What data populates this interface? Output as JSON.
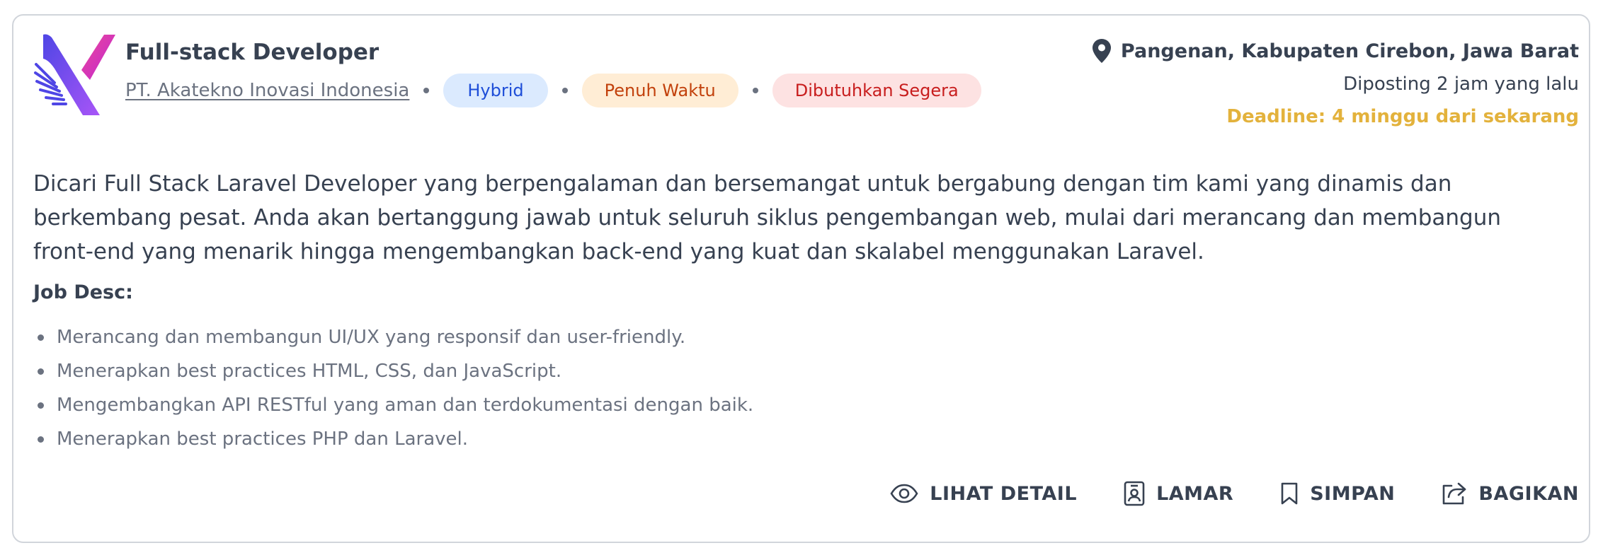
{
  "job": {
    "title": "Full-stack Developer",
    "company": "PT. Akatekno Inovasi Indonesia",
    "tags": [
      {
        "label": "Hybrid",
        "bg": "#dbeafe",
        "color": "#1e4ed8"
      },
      {
        "label": "Penuh Waktu",
        "bg": "#ffedd5",
        "color": "#c2410c"
      },
      {
        "label": "Dibutuhkan Segera",
        "bg": "#fde2e2",
        "color": "#c81e1e"
      }
    ],
    "location": "Pangenan, Kabupaten Cirebon, Jawa Barat",
    "posted": "Diposting 2 jam yang lalu",
    "deadline": "Deadline: 4 minggu dari sekarang",
    "description": "Dicari Full Stack Laravel Developer yang berpengalaman dan bersemangat untuk bergabung dengan tim kami yang dinamis dan berkembang pesat. Anda akan bertanggung jawab untuk seluruh siklus pengembangan web, mulai dari merancang dan membangun front-end yang menarik hingga mengembangkan back-end yang kuat dan skalabel menggunakan Laravel.",
    "job_desc_label": "Job Desc:",
    "job_desc_items": [
      "Merancang dan membangun UI/UX yang responsif dan user-friendly.",
      "Menerapkan best practices HTML, CSS, dan JavaScript.",
      "Mengembangkan API RESTful yang aman dan terdokumentasi dengan baik.",
      "Menerapkan best practices PHP dan Laravel."
    ]
  },
  "actions": {
    "detail": {
      "label": "LIHAT DETAIL",
      "icon": "eye-icon"
    },
    "apply": {
      "label": "LAMAR",
      "icon": "badge-icon"
    },
    "save": {
      "label": "SIMPAN",
      "icon": "bookmark-icon"
    },
    "share": {
      "label": "BAGIKAN",
      "icon": "share-icon"
    }
  },
  "colors": {
    "brand_gradient_start": "#5b3df5",
    "brand_gradient_end": "#e040fb",
    "deadline": "#e3b23c",
    "text_primary": "#374151",
    "text_muted": "#6b7280"
  }
}
